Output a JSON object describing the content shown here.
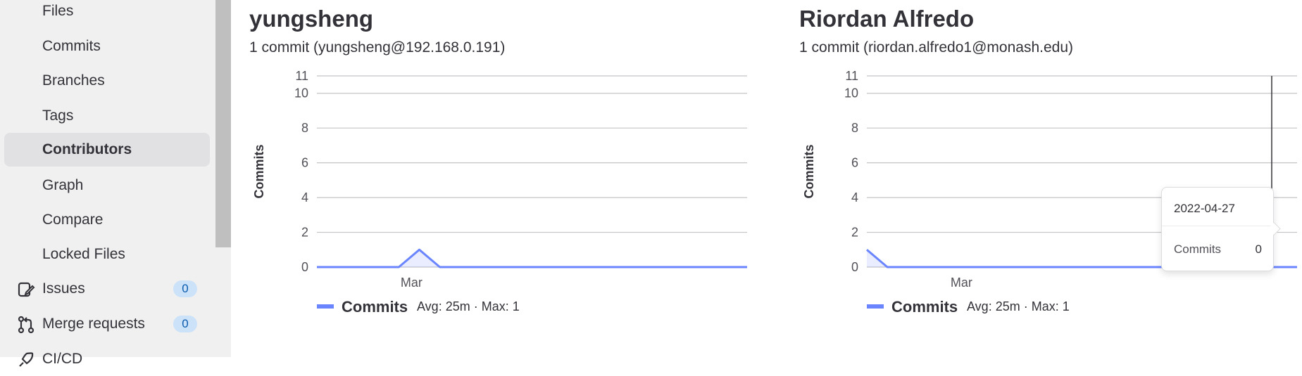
{
  "sidebar": {
    "items": [
      {
        "label": "Files",
        "active": false
      },
      {
        "label": "Commits",
        "active": false
      },
      {
        "label": "Branches",
        "active": false
      },
      {
        "label": "Tags",
        "active": false
      },
      {
        "label": "Contributors",
        "active": true
      },
      {
        "label": "Graph",
        "active": false
      },
      {
        "label": "Compare",
        "active": false
      },
      {
        "label": "Locked Files",
        "active": false
      },
      {
        "label": "Issues",
        "icon": "issues-icon",
        "badge": "0"
      },
      {
        "label": "Merge requests",
        "icon": "merge-request-icon",
        "badge": "0"
      },
      {
        "label": "CI/CD",
        "icon": "rocket-icon"
      }
    ]
  },
  "contributors": [
    {
      "name": "yungsheng",
      "summary": "1 commit (yungsheng@192.168.0.191)",
      "legend_label": "Commits",
      "legend_stats": "Avg: 25m · Max: 1",
      "chart_data": {
        "type": "area",
        "ylabel": "Commits",
        "xlabel": "",
        "yticks": [
          0,
          2,
          4,
          6,
          8,
          10,
          11
        ],
        "ylim": [
          0,
          11
        ],
        "xtick_labels": [
          "Mar"
        ],
        "series": [
          {
            "values": [
              0,
              0,
              0,
              0,
              0,
              1,
              0,
              0,
              0,
              0,
              0,
              0,
              0,
              0,
              0,
              0,
              0,
              0,
              0,
              0,
              0,
              0
            ]
          }
        ],
        "color": "#6b85ff"
      }
    },
    {
      "name": "Riordan Alfredo",
      "summary": "1 commit (riordan.alfredo1@monash.edu)",
      "legend_label": "Commits",
      "legend_stats": "Avg: 25m · Max: 1",
      "tooltip": {
        "date": "2022-04-27",
        "label": "Commits",
        "value": "0"
      },
      "chart_data": {
        "type": "area",
        "ylabel": "Commits",
        "xlabel": "",
        "yticks": [
          0,
          2,
          4,
          6,
          8,
          10,
          11
        ],
        "ylim": [
          0,
          11
        ],
        "xtick_labels": [
          "Mar"
        ],
        "series": [
          {
            "values": [
              1,
              0,
              0,
              0,
              0,
              0,
              0,
              0,
              0,
              0,
              0,
              0,
              0,
              0,
              0,
              0,
              0,
              0,
              0,
              0,
              0,
              0
            ]
          }
        ],
        "color": "#6b85ff"
      }
    }
  ]
}
